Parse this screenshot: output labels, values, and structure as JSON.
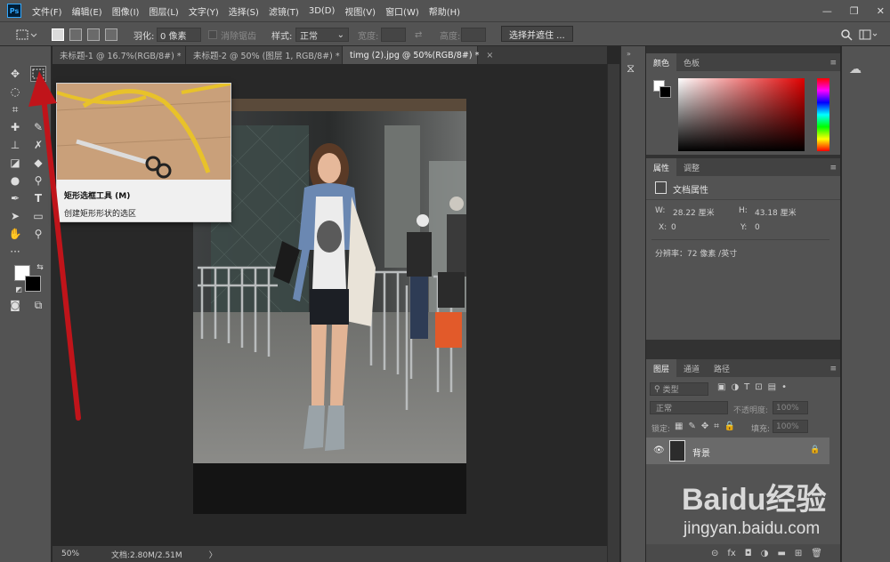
{
  "app": {
    "logo": "Ps"
  },
  "menu": [
    "文件(F)",
    "编辑(E)",
    "图像(I)",
    "图层(L)",
    "文字(Y)",
    "选择(S)",
    "滤镜(T)",
    "3D(D)",
    "视图(V)",
    "窗口(W)",
    "帮助(H)"
  ],
  "window_controls": {
    "minimize": "—",
    "restore": "❐",
    "close": "✕"
  },
  "options": {
    "feather_label": "羽化:",
    "feather_value": "0 像素",
    "antialias_label": "消除锯齿",
    "style_label": "样式:",
    "style_value": "正常",
    "width_label": "宽度:",
    "height_label": "高度:",
    "select_mask_button": "选择并遮住 ..."
  },
  "tabs": [
    {
      "label": "未标题-1 @ 16.7%(RGB/8#) *",
      "close": "×"
    },
    {
      "label": "未标题-2 @ 50% (图层 1, RGB/8#) *",
      "close": "×"
    },
    {
      "label": "timg (2).jpg @ 50%(RGB/8#) *",
      "close": "×"
    }
  ],
  "tooltip": {
    "title": "矩形选框工具 (M)",
    "description": "创建矩形形状的选区"
  },
  "status": {
    "zoom": "50%",
    "doc": "文档:2.80M/2.51M",
    "arrow": "〉"
  },
  "color_panel": {
    "tabs": [
      "颜色",
      "色板"
    ]
  },
  "properties_panel": {
    "tabs": [
      "属性",
      "调整"
    ],
    "section": "文档属性",
    "w_label": "W:",
    "w_value": "28.22 厘米",
    "h_label": "H:",
    "h_value": "43.18 厘米",
    "x_label": "X:",
    "x_value": "0",
    "y_label": "Y:",
    "y_value": "0",
    "resolution": "分辨率：72 像素 /英寸"
  },
  "layers_panel": {
    "tabs": [
      "图层",
      "通道",
      "路径"
    ],
    "filter_kind": "类型",
    "blend_mode": "正常",
    "opacity_label": "不透明度:",
    "opacity_value": "100%",
    "lock_label": "锁定:",
    "fill_label": "填充:",
    "fill_value": "100%",
    "layer_name": "背景"
  },
  "watermark": {
    "brand": "Baidu经验",
    "url": "jingyan.baidu.com"
  },
  "colors": {
    "accent_arrow": "#c0141a",
    "panel_bg": "#535353",
    "canvas_bg": "#282828"
  }
}
